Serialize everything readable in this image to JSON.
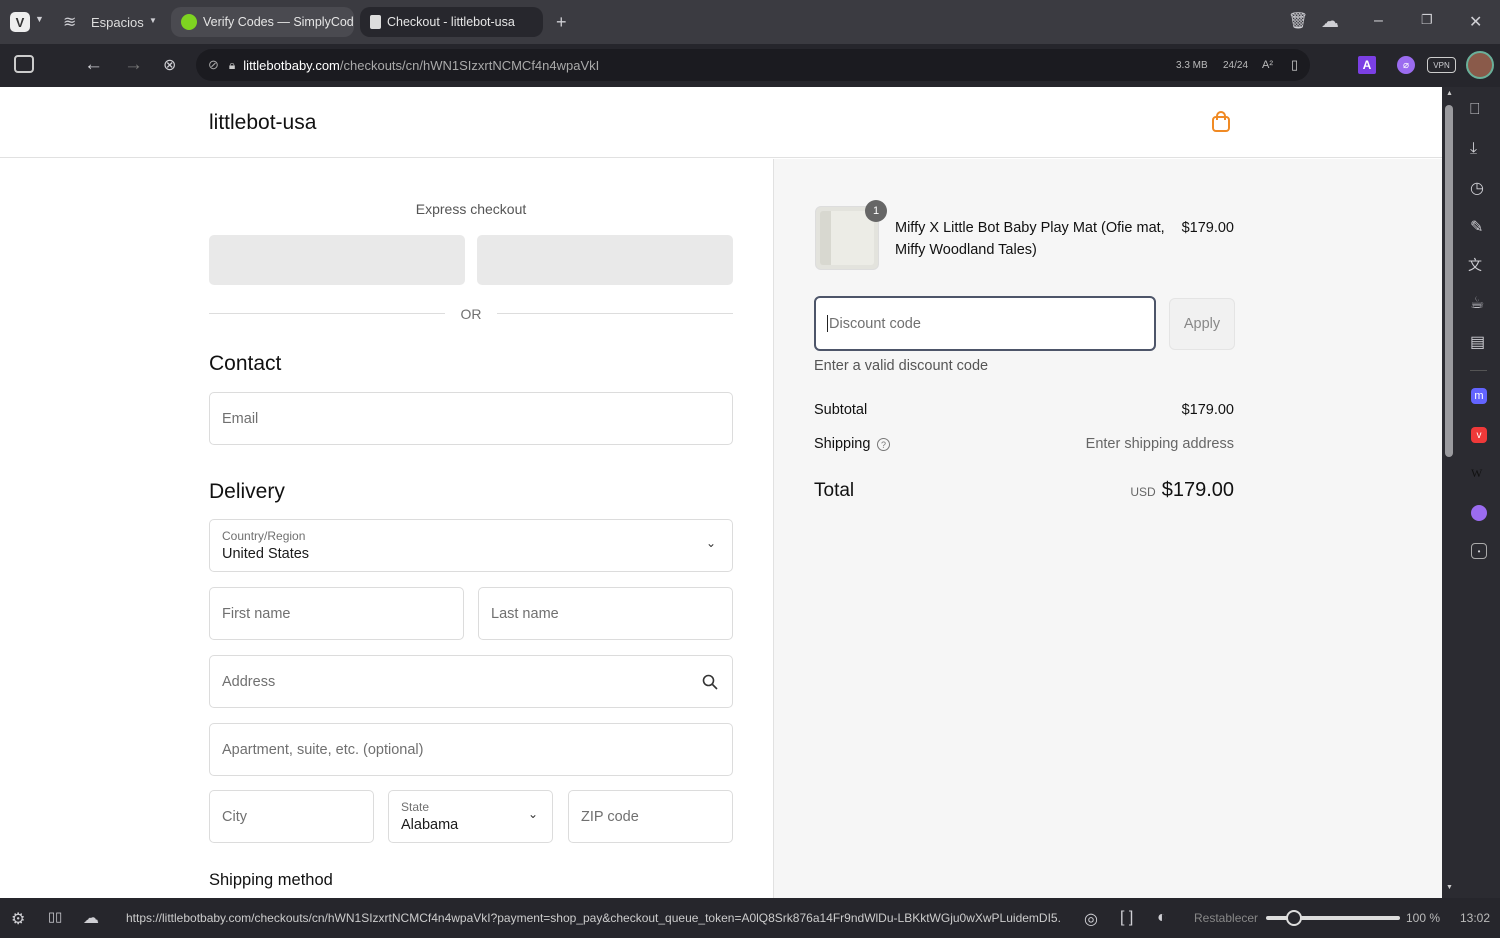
{
  "browser": {
    "spaces_label": "Espacios",
    "tabs": [
      {
        "title": "Verify Codes — SimplyCodes"
      },
      {
        "title": "Checkout - littlebot-usa"
      }
    ],
    "url_domain": "littlebotbaby.com",
    "url_path": "/checkouts/cn/hWN1SIzxrtNCMCf4n4wpaVkI",
    "page_size": "3.3 MB",
    "tracker_count": "24/24",
    "vpn_label": "VPN",
    "status_url": "https://littlebotbaby.com/checkouts/cn/hWN1SIzxrtNCMCf4n4wpaVkI?payment=shop_pay&checkout_queue_token=A0lQ8Srk876a14Fr9ndWlDu-LBKktWGju0wXwPLuidemDI5...",
    "reset_label": "Restablecer",
    "zoom": "100 %",
    "zoom_percent": 100,
    "time": "13:02"
  },
  "store": {
    "name": "littlebot-usa"
  },
  "checkout": {
    "express_label": "Express checkout",
    "or_label": "OR",
    "contact_heading": "Contact",
    "email_placeholder": "Email",
    "delivery_heading": "Delivery",
    "country_label": "Country/Region",
    "country_value": "United States",
    "first_name_placeholder": "First name",
    "last_name_placeholder": "Last name",
    "address_placeholder": "Address",
    "apartment_placeholder": "Apartment, suite, etc. (optional)",
    "city_placeholder": "City",
    "state_label": "State",
    "state_value": "Alabama",
    "zip_placeholder": "ZIP code",
    "shipping_method_heading": "Shipping method"
  },
  "summary": {
    "item": {
      "name": "Miffy X Little Bot Baby Play Mat (Ofie mat, Miffy Woodland Tales)",
      "price": "$179.00",
      "quantity": "1"
    },
    "discount_placeholder": "Discount code",
    "apply_label": "Apply",
    "discount_error": "Enter a valid discount code",
    "subtotal_label": "Subtotal",
    "subtotal_value": "$179.00",
    "shipping_label": "Shipping",
    "shipping_value": "Enter shipping address",
    "total_label": "Total",
    "currency": "USD",
    "total_value": "$179.00"
  }
}
